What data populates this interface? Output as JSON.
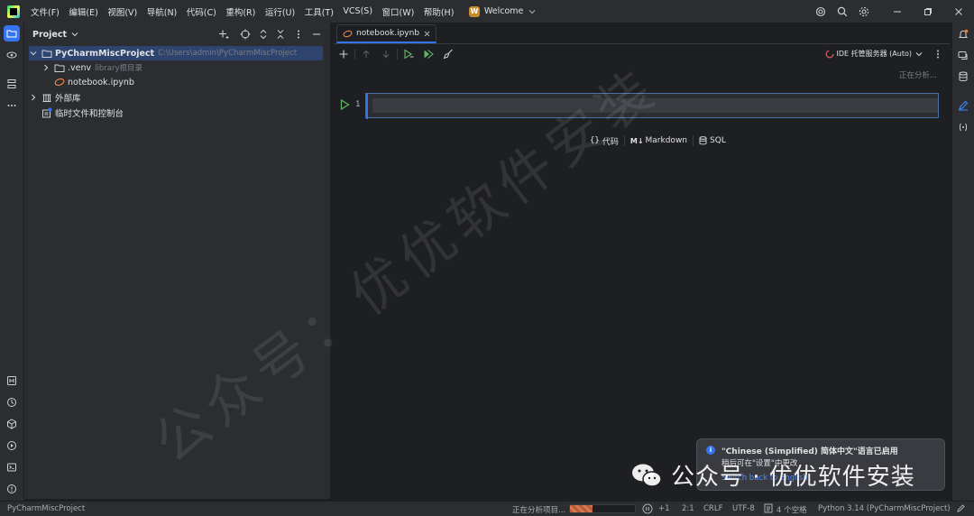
{
  "titlebar": {
    "menu": [
      "文件(F)",
      "编辑(E)",
      "视图(V)",
      "导航(N)",
      "代码(C)",
      "重构(R)",
      "运行(U)",
      "工具(T)",
      "VCS(S)",
      "窗口(W)",
      "帮助(H)"
    ],
    "welcome_badge": "W",
    "welcome_label": "Welcome"
  },
  "project": {
    "title": "Project",
    "tree": [
      {
        "label": "PyCharmMiscProject",
        "path": "C:\\Users\\admin\\PyCharmMiscProject"
      },
      {
        "label": ".venv",
        "note": "library根目录"
      },
      {
        "label": "notebook.ipynb"
      },
      {
        "label": "外部库"
      },
      {
        "label": "临时文件和控制台"
      }
    ]
  },
  "editor": {
    "tab_label": "notebook.ipynb",
    "kernel_label": "IDE 托管服务器 (Auto)",
    "analyzing": "正在分析...",
    "cell_number": "1",
    "add_code": "代码",
    "add_markdown": "Markdown",
    "add_markdown_prefix": "M↓",
    "add_sql": "SQL"
  },
  "notification": {
    "title": "\"Chinese (Simplified) 简体中文\"语言已启用",
    "body": "稍后可在\"设置\"中更改",
    "link": "Switch back to English"
  },
  "statusbar": {
    "project": "PyCharmMiscProject",
    "analyzing": "正在分析项目...",
    "progress": 0.35,
    "plus": "+1",
    "position": "2:1",
    "line_ending": "CRLF",
    "encoding": "UTF-8",
    "indent": "4 个空格",
    "interpreter": "Python 3.14 (PyCharmMiscProject)"
  },
  "watermark": {
    "diagonal": "公众号：优优软件安装",
    "footer": "公众号 · 优优软件安装"
  },
  "colors": {
    "accent": "#3574f0",
    "selection": "#2e436e",
    "run_green": "#5fb865",
    "ipynb_orange": "#e8834a"
  }
}
